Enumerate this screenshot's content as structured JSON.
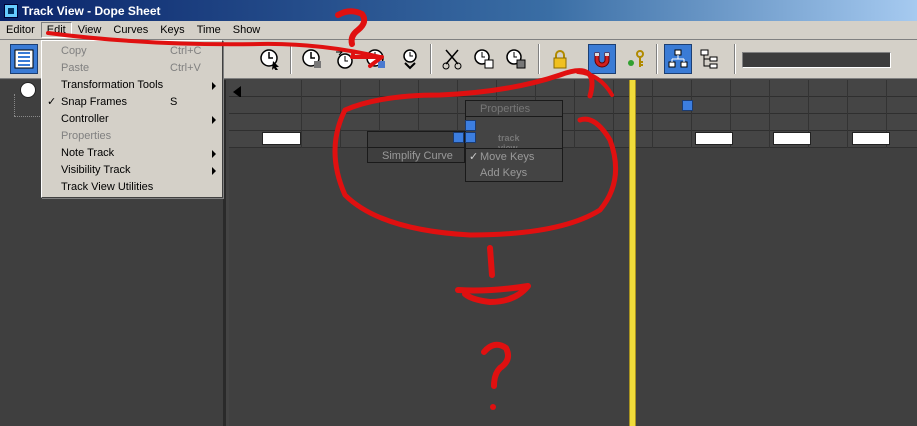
{
  "window": {
    "title": "Track View - Dope Sheet"
  },
  "menubar": {
    "items": [
      "Editor",
      "Edit",
      "View",
      "Curves",
      "Keys",
      "Time",
      "Show"
    ],
    "active": "Edit"
  },
  "edit_menu": {
    "items": [
      {
        "label": "Copy",
        "shortcut": "Ctrl+C",
        "disabled": true
      },
      {
        "label": "Paste",
        "shortcut": "Ctrl+V",
        "disabled": true
      },
      {
        "label": "Transformation Tools",
        "submenu": true
      },
      {
        "label": "Snap Frames",
        "shortcut": "S",
        "checked": true
      },
      {
        "label": "Controller",
        "submenu": true
      },
      {
        "label": "Properties",
        "disabled": true
      },
      {
        "label": "Note Track",
        "submenu": true
      },
      {
        "label": "Visibility Track",
        "submenu": true
      },
      {
        "label": "Track View Utilities"
      }
    ]
  },
  "quad_menu": {
    "properties_label": "Properties",
    "track_view_key_label": "track view key",
    "simplify_curve_label": "Simplify Curve",
    "move_keys_label": "Move Keys",
    "add_keys_label": "Add Keys",
    "check_glyph": "✓"
  },
  "toolbar": {
    "icons": [
      "dope-sheet-icon",
      "select-keys-icon",
      "slide-keys-icon",
      "add-remove-time-icon",
      "scale-keys-icon",
      "move-keys-icon",
      "cut-icon",
      "copy-icon",
      "paste-icon",
      "lock-icon",
      "snap-magnet-icon",
      "show-keyable-icon",
      "hierarchy-icon",
      "tree-icon"
    ]
  },
  "annotation": {
    "question_top": "?",
    "question_bottom": "?"
  },
  "colors": {
    "annotation_red": "#e01010",
    "time_slider": "#f0dc3a",
    "selected_blue": "#3c7ee0"
  }
}
